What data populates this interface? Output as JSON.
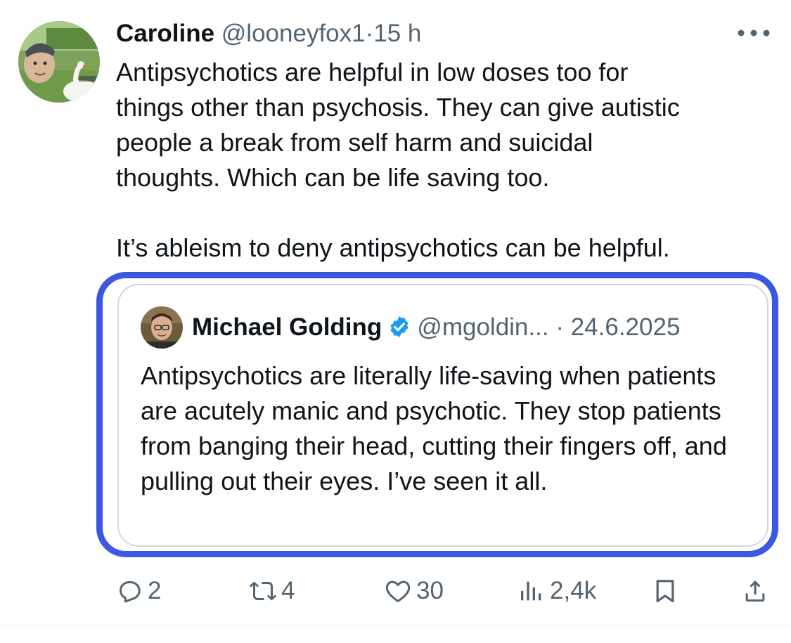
{
  "tweet": {
    "author_name": "Caroline",
    "author_handle": "@looneyfox1",
    "separator": "·",
    "time": "15 h",
    "text": "Antipsychotics are helpful in low doses too for\nthings other than psychosis.  They can give autistic\npeople a break from self harm and suicidal\nthoughts.  Which can be life saving too.\n\nIt’s ableism to deny antipsychotics can be helpful.",
    "more_icon": "more-horizontal-icon"
  },
  "quote": {
    "author_name": "Michael Golding",
    "verified": true,
    "author_handle": "@mgoldin...",
    "separator": "·",
    "date": "24.6.2025",
    "text": "Antipsychotics are literally life-saving when patients are acutely manic and psychotic. They stop patients from banging their head, cutting their fingers off, and pulling out their eyes. I’ve seen it all."
  },
  "actions": {
    "replies": "2",
    "reposts": "4",
    "likes": "30",
    "views": "2,4k",
    "icons": [
      "reply-icon",
      "repost-icon",
      "like-icon",
      "views-icon",
      "bookmark-icon",
      "share-icon"
    ]
  },
  "colors": {
    "text": "#0f1419",
    "secondary": "#536471",
    "highlight": "#3a58e2",
    "verified": "#1d9bf0",
    "border": "#cfd9de"
  }
}
